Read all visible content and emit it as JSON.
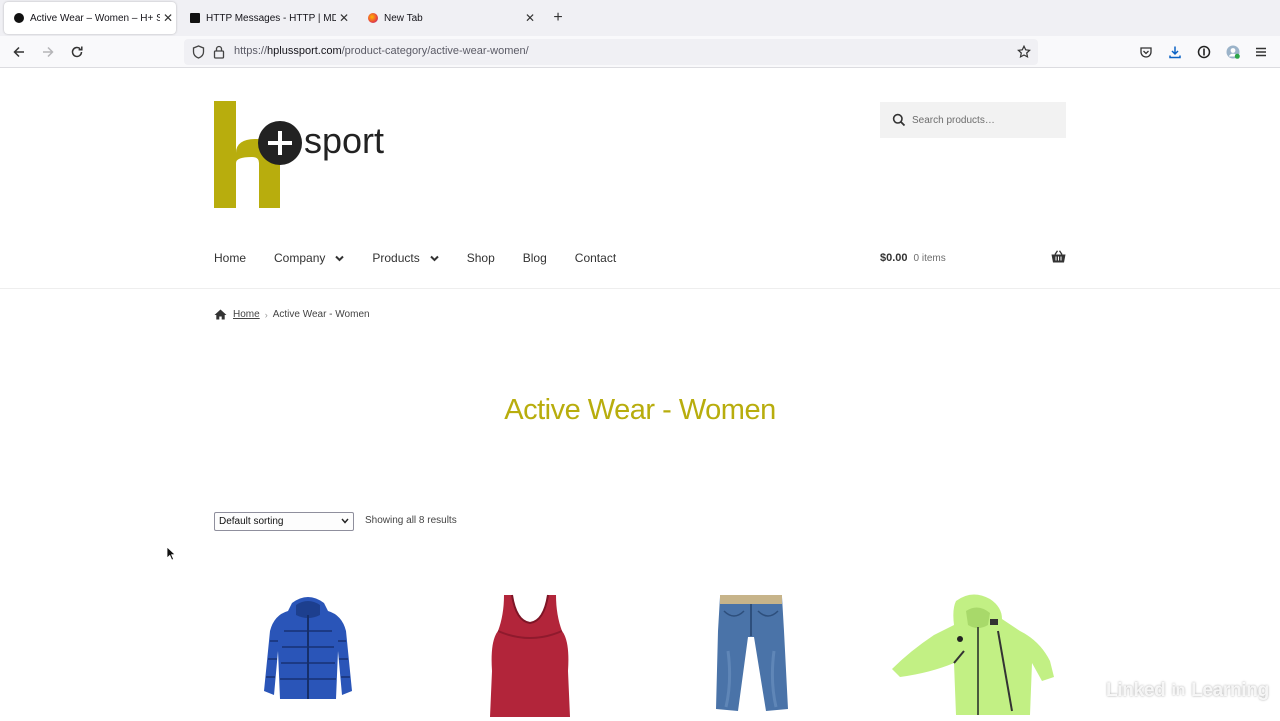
{
  "browser": {
    "tabs": [
      {
        "title": "Active Wear – Women – H+ Sport",
        "active": true
      },
      {
        "title": "HTTP Messages - HTTP | MDN",
        "active": false
      },
      {
        "title": "New Tab",
        "active": false
      }
    ],
    "url_prefix": "https://",
    "url_host": "hplussport.com",
    "url_path": "/product-category/active-wear-women/",
    "icons": [
      "back-arrow-icon",
      "forward-arrow-icon",
      "reload-icon",
      "shield-icon",
      "lock-icon",
      "star-icon",
      "pocket-icon",
      "download-icon",
      "password-icon",
      "account-icon",
      "hamburger-menu-icon"
    ]
  },
  "site": {
    "logo_word": "sport",
    "search_placeholder": "Search products…",
    "nav": [
      {
        "label": "Home",
        "dropdown": false
      },
      {
        "label": "Company",
        "dropdown": true
      },
      {
        "label": "Products",
        "dropdown": true
      },
      {
        "label": "Shop",
        "dropdown": false
      },
      {
        "label": "Blog",
        "dropdown": false
      },
      {
        "label": "Contact",
        "dropdown": false
      }
    ],
    "cart": {
      "amount": "$0.00",
      "count": "0 items"
    },
    "breadcrumb": {
      "home": "Home",
      "current": "Active Wear - Women"
    },
    "heading": "Active Wear - Women",
    "sorting": "Default sorting",
    "results": "Showing all 8 results",
    "colors": {
      "brand": "#b8ad0d",
      "text": "#333333"
    }
  },
  "products": [
    {
      "item": "blue puffer jacket"
    },
    {
      "item": "red tank top"
    },
    {
      "item": "blue jeans"
    },
    {
      "item": "lime green windbreaker"
    }
  ],
  "watermark": {
    "left": "Linked",
    "box": "in",
    "right": "Learning"
  }
}
